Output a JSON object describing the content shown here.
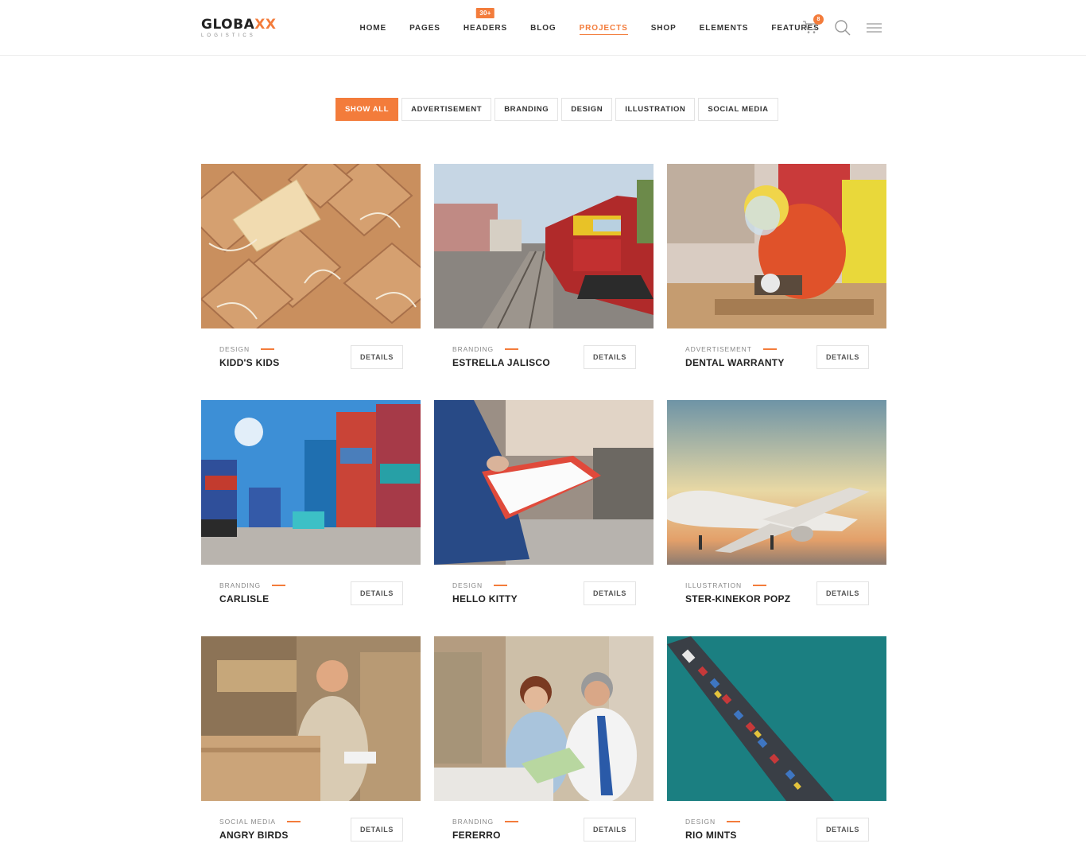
{
  "brand": {
    "logo_main": "GLOBA",
    "logo_accent": "XX",
    "logo_sub": "LOGISTICS",
    "accent_color": "#f37c3b"
  },
  "nav": {
    "items": [
      {
        "label": "HOME"
      },
      {
        "label": "PAGES"
      },
      {
        "label": "HEADERS",
        "badge": "30+"
      },
      {
        "label": "BLOG"
      },
      {
        "label": "PROJECTS",
        "active": true
      },
      {
        "label": "SHOP"
      },
      {
        "label": "ELEMENTS"
      },
      {
        "label": "FEATURES"
      }
    ],
    "cart_count": "8",
    "icons": [
      "cart-icon",
      "search-icon",
      "hamburger-menu-icon"
    ]
  },
  "filters": [
    {
      "label": "SHOW ALL",
      "active": true
    },
    {
      "label": "ADVERTISEMENT"
    },
    {
      "label": "BRANDING"
    },
    {
      "label": "DESIGN"
    },
    {
      "label": "ILLUSTRATION"
    },
    {
      "label": "SOCIAL MEDIA"
    }
  ],
  "projects": [
    {
      "category": "DESIGN",
      "title": "KIDD'S KIDS",
      "button": "DETAILS",
      "image": "kraft-paper-parcels"
    },
    {
      "category": "BRANDING",
      "title": "ESTRELLA JALISCO",
      "button": "DETAILS",
      "image": "freight-train-on-tracks"
    },
    {
      "category": "ADVERTISEMENT",
      "title": "DENTAL WARRANTY",
      "button": "DETAILS",
      "image": "worker-grinding-metal"
    },
    {
      "category": "BRANDING",
      "title": "CARLISLE",
      "button": "DETAILS",
      "image": "shipping-container-yard"
    },
    {
      "category": "DESIGN",
      "title": "HELLO KITTY",
      "button": "DETAILS",
      "image": "clipboard-in-warehouse"
    },
    {
      "category": "ILLUSTRATION",
      "title": "STER-KINEKOR POPZ",
      "button": "DETAILS",
      "image": "airplane-at-sunset"
    },
    {
      "category": "SOCIAL MEDIA",
      "title": "ANGRY BIRDS",
      "button": "DETAILS",
      "image": "man-with-cardboard-boxes"
    },
    {
      "category": "BRANDING",
      "title": "FERERRO",
      "button": "DETAILS",
      "image": "office-workers-on-phone"
    },
    {
      "category": "DESIGN",
      "title": "RIO MINTS",
      "button": "DETAILS",
      "image": "aerial-container-ship"
    }
  ]
}
